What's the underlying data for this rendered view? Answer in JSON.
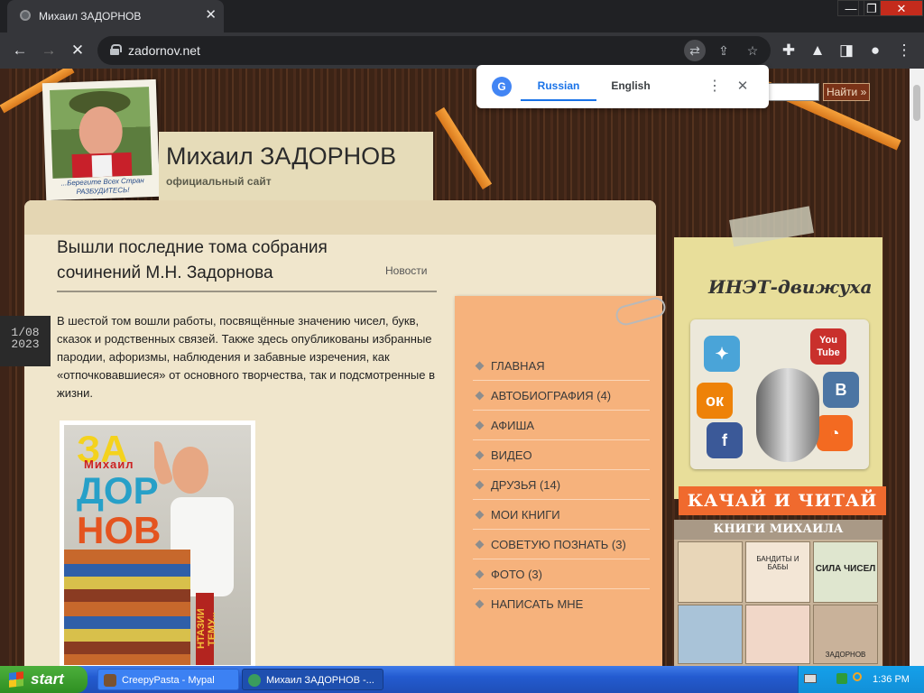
{
  "browser": {
    "tab_title": "Михаил ЗАДОРНОВ",
    "tab_close": "✕",
    "url": "zadornov.net",
    "window_controls": [
      "—",
      "❐",
      "✕"
    ]
  },
  "translate_popup": {
    "logo": "G",
    "lang_source": "Russian",
    "lang_target": "English",
    "more": "⋮",
    "close": "✕"
  },
  "site": {
    "title": "Михаил ЗАДОРНОВ",
    "subtitle": "официальный сайт",
    "photo_caption": "...Берегите Всех Стран РАЗБУДИТЕСЬ!",
    "search_button": "Найти »",
    "search_placeholder": ""
  },
  "article": {
    "headline": "Вышли последние тома собрания сочинений М.Н. Задорнова",
    "category": "Новости",
    "body": "В шестой том вошли работы, посвящённые значению чисел, букв, сказок и родственных связей. Также здесь опубликованы избранные пародии, афоризмы, наблюдения и забавные изречения, как «отпочковавшиеся» от основного творчества, так и подсмотренные в жизни.",
    "date_line1": "1/08",
    "date_line2": "2023",
    "cover_top": "ЗА",
    "cover_name": "Михаил",
    "cover_mid": "ДОР",
    "cover_bottom": "НОВ",
    "cover_stripe": "НТАЗИИ   ТЕМУ..."
  },
  "menu": {
    "items": [
      "ГЛАВНАЯ",
      "АВТОБИОГРАФИЯ (4)",
      "АФИША",
      "ВИДЕО",
      "ДРУЗЬЯ (14)",
      "МОИ КНИГИ",
      "СОВЕТУЮ ПОЗНАТЬ (3)",
      "ФОТО (3)",
      "НАПИСАТЬ МНЕ"
    ]
  },
  "sidebar": {
    "heading": "ИНЭТ-движуха",
    "social_labels": [
      "You Tube",
      "B",
      "ок",
      "f"
    ],
    "download_banner": "КАЧАЙ И ЧИТАЙ",
    "books_heading": "КНИГИ МИХАИЛА ЗАДОРНОВА",
    "book_titles": [
      "БАНДИТЫ И БАБЫ",
      "СИЛА ЧИСЕЛ",
      "ЗАДОРНОВ"
    ]
  },
  "taskbar": {
    "start_label": "start",
    "tasks": [
      "CreepyPasta - Mypal",
      "Михаил ЗАДОРНОВ -..."
    ],
    "clock": "1:36 PM"
  },
  "colors": {
    "menu_bg": "#f6b27c",
    "accent_orange": "#f06a2e",
    "translate_blue": "#1a73e8"
  }
}
